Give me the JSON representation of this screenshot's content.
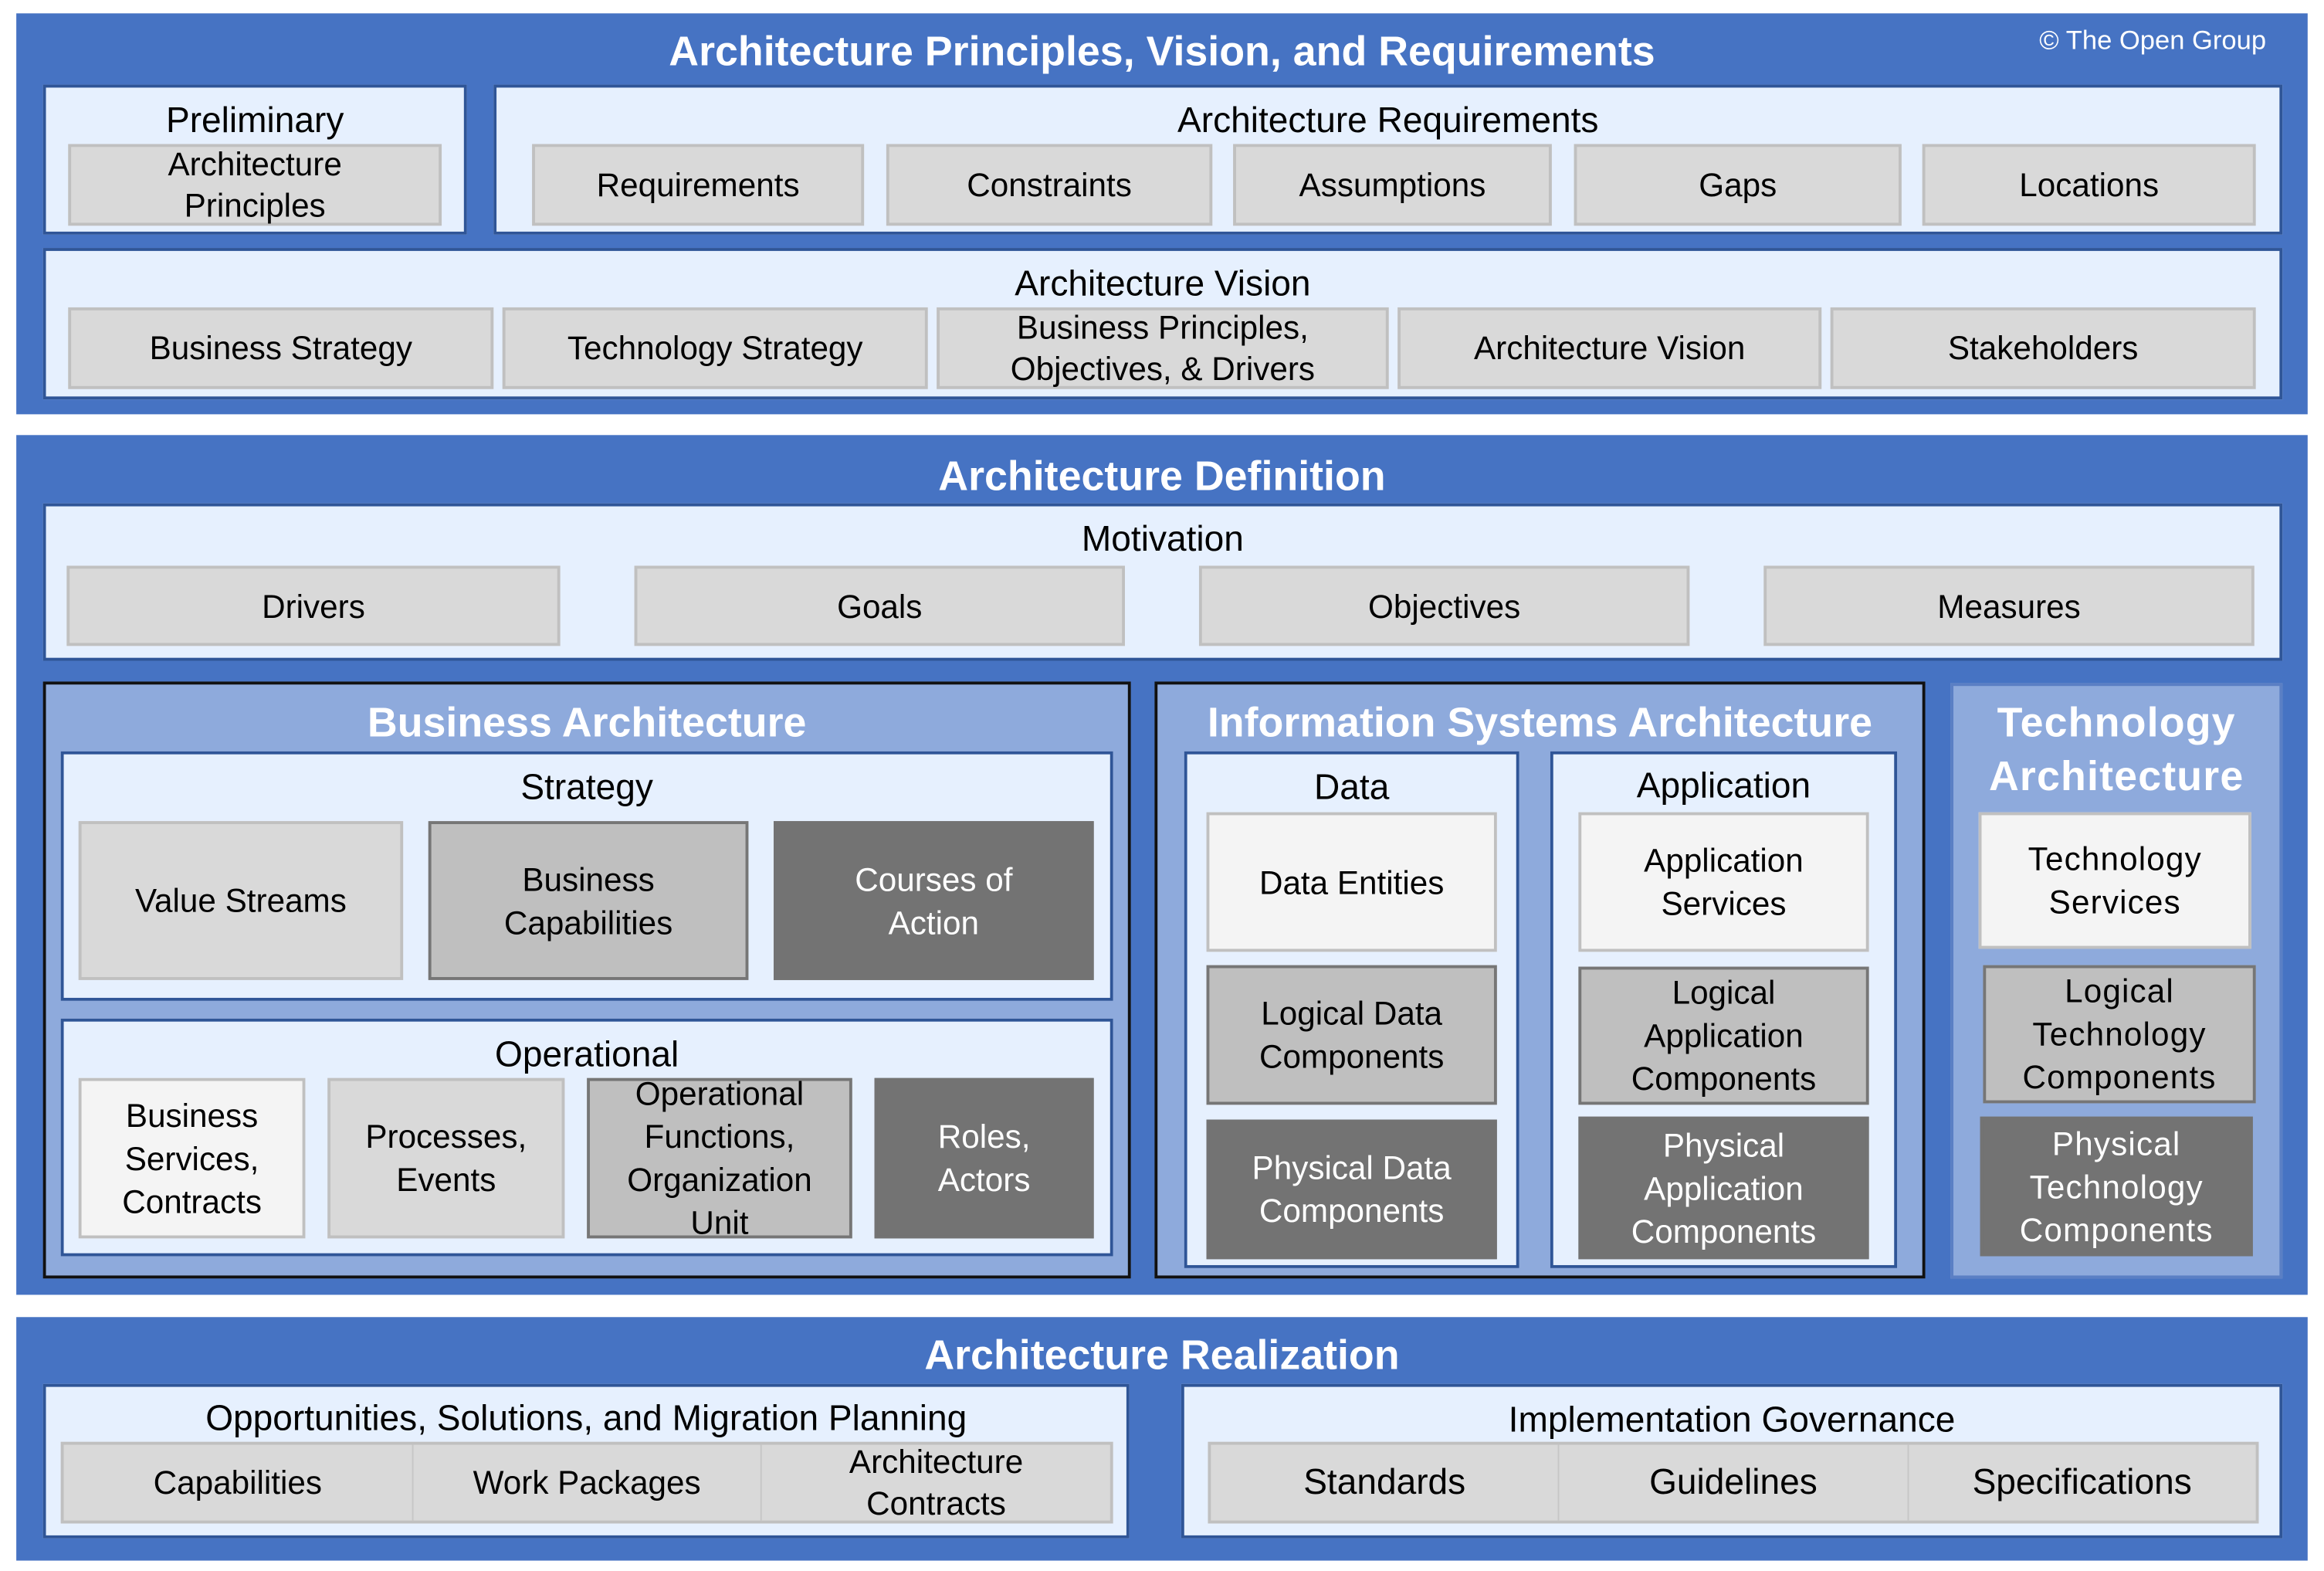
{
  "copyright": "© The Open Group",
  "colors": {
    "section_blue": "#4673c3",
    "panel_fill": "#e6f0fe",
    "subarch_fill": "#8eaadc",
    "box_white": "#f4f4f4",
    "box_light": "#d9d9d9",
    "box_mid": "#bfbfbf",
    "box_dark": "#737373"
  },
  "principles": {
    "title": "Architecture Principles, Vision, and Requirements",
    "preliminary": {
      "label": "Preliminary",
      "items": [
        "Architecture\nPrinciples"
      ]
    },
    "requirements": {
      "label": "Architecture Requirements",
      "items": [
        "Requirements",
        "Constraints",
        "Assumptions",
        "Gaps",
        "Locations"
      ]
    },
    "vision": {
      "label": "Architecture Vision",
      "items": [
        "Business Strategy",
        "Technology Strategy",
        "Business Principles,\nObjectives, & Drivers",
        "Architecture Vision",
        "Stakeholders"
      ]
    }
  },
  "definition": {
    "title": "Architecture Definition",
    "motivation": {
      "label": "Motivation",
      "items": [
        "Drivers",
        "Goals",
        "Objectives",
        "Measures"
      ]
    },
    "business": {
      "title": "Business Architecture",
      "strategy": {
        "label": "Strategy",
        "items": [
          "Value Streams",
          "Business\nCapabilities",
          "Courses of\nAction"
        ]
      },
      "operational": {
        "label": "Operational",
        "items": [
          "Business\nServices,\nContracts",
          "Processes,\nEvents",
          "Operational\nFunctions,\nOrganization\nUnit",
          "Roles,\nActors"
        ]
      }
    },
    "information_systems": {
      "title": "Information Systems Architecture",
      "data": {
        "label": "Data",
        "items": [
          "Data Entities",
          "Logical Data\nComponents",
          "Physical Data\nComponents"
        ]
      },
      "application": {
        "label": "Application",
        "items": [
          "Application\nServices",
          "Logical\nApplication\nComponents",
          "Physical\nApplication\nComponents"
        ]
      }
    },
    "technology": {
      "title": "Technology\nArchitecture",
      "items": [
        "Technology\nServices",
        "Logical\nTechnology\nComponents",
        "Physical\nTechnology\nComponents"
      ]
    }
  },
  "realization": {
    "title": "Architecture Realization",
    "opportunities": {
      "label": "Opportunities, Solutions, and Migration Planning",
      "items": [
        "Capabilities",
        "Work Packages",
        "Architecture\nContracts"
      ]
    },
    "governance": {
      "label": "Implementation Governance",
      "items": [
        "Standards",
        "Guidelines",
        "Specifications"
      ]
    }
  }
}
